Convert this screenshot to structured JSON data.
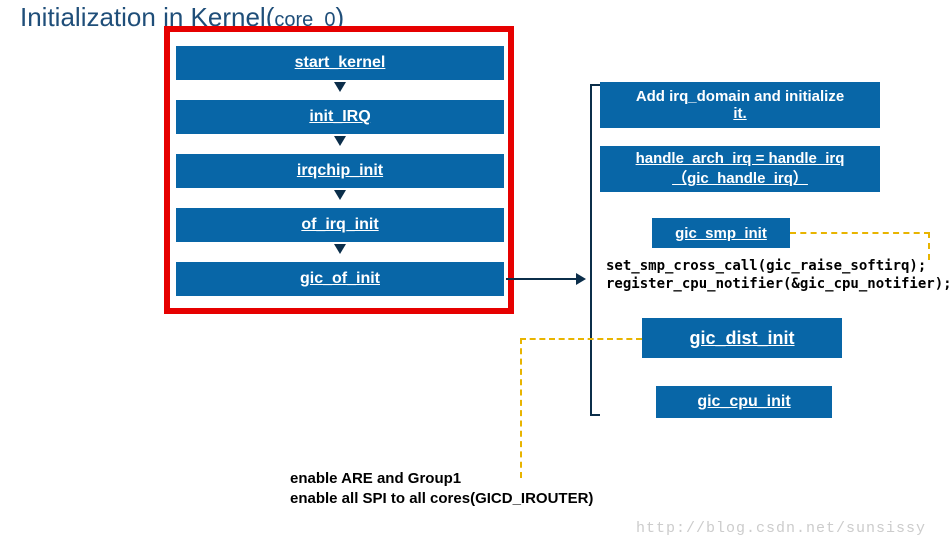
{
  "title": {
    "main": "Initialization in Kernel(",
    "sub": "core_0",
    "close": ")"
  },
  "flow": [
    {
      "label": "start_kernel"
    },
    {
      "label": "init_IRQ"
    },
    {
      "label": "irqchip_init"
    },
    {
      "label": "of_irq_init"
    },
    {
      "label": "gic_of_init"
    }
  ],
  "right": {
    "r1_line1": "Add irq_domain and initialize",
    "r1_line2": "it.",
    "r2_line1": "handle_arch_irq = handle_irq",
    "r2_line2": "（gic_handle_irq）",
    "r3": "gic_smp_init",
    "code1": "set_smp_cross_call(gic_raise_softirq);",
    "code2": "register_cpu_notifier(&gic_cpu_notifier);",
    "r4": "gic_dist_init",
    "r5": "gic_cpu_init"
  },
  "bottom": {
    "line1": "enable ARE and Group1",
    "line2": "enable all SPI to all cores(GICD_IROUTER)"
  },
  "watermark": "http://blog.csdn.net/sunsissy"
}
